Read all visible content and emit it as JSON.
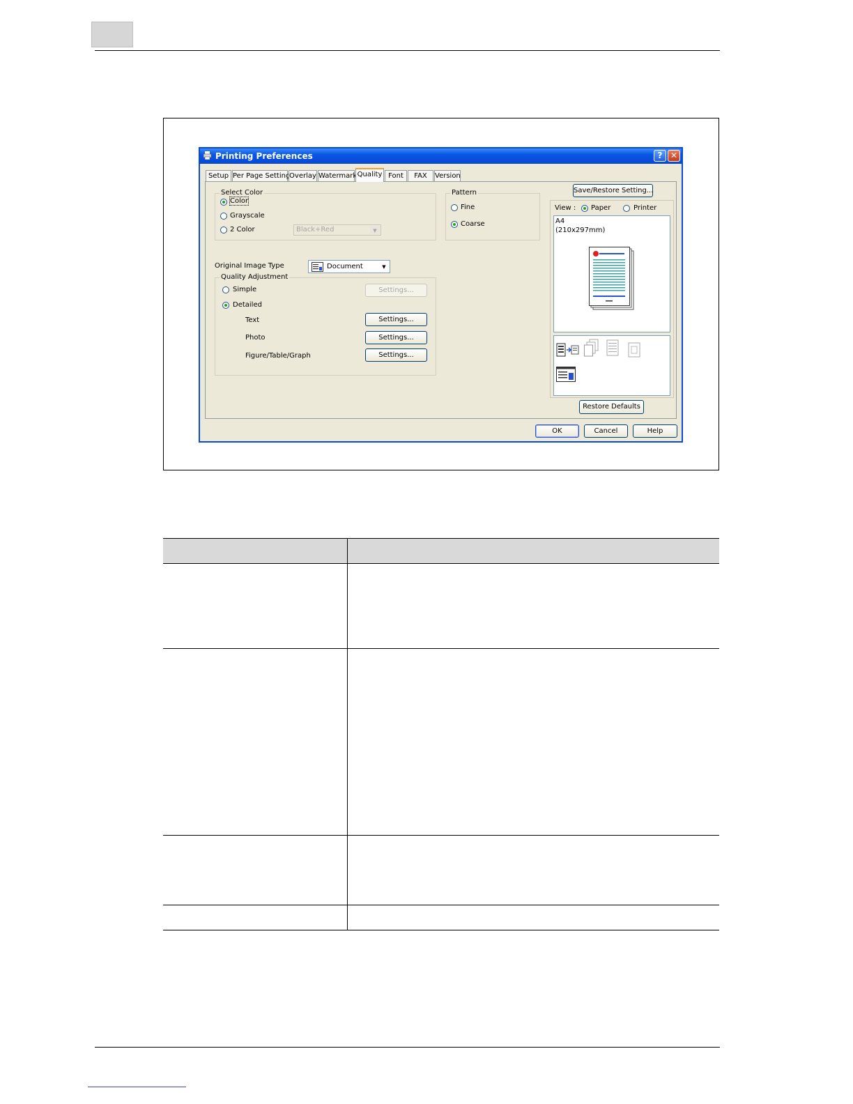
{
  "dialog": {
    "title": "Printing Preferences",
    "help_symbol": "?",
    "close_symbol": "✕",
    "tabs": [
      {
        "label": "Setup"
      },
      {
        "label": "Per Page Setting"
      },
      {
        "label": "Overlay"
      },
      {
        "label": "Watermark"
      },
      {
        "label": "Quality"
      },
      {
        "label": "Font"
      },
      {
        "label": "FAX"
      },
      {
        "label": "Version"
      }
    ],
    "active_tab": "Quality",
    "select_color": {
      "label": "Select Color",
      "options": [
        {
          "label": "Color",
          "selected": true
        },
        {
          "label": "Grayscale",
          "selected": false
        },
        {
          "label": "2 Color",
          "selected": false
        }
      ],
      "two_color_value": "Black+Red",
      "two_color_enabled": false
    },
    "pattern": {
      "label": "Pattern",
      "options": [
        {
          "label": "Fine",
          "selected": false
        },
        {
          "label": "Coarse",
          "selected": true
        }
      ]
    },
    "original_image_type": {
      "label": "Original Image Type",
      "value": "Document"
    },
    "quality_adjustment": {
      "label": "Quality Adjustment",
      "simple_label": "Simple",
      "detailed_label": "Detailed",
      "selected": "Detailed",
      "simple_settings_label": "Settings...",
      "rows": [
        {
          "label": "Text",
          "button": "Settings..."
        },
        {
          "label": "Photo",
          "button": "Settings..."
        },
        {
          "label": "Figure/Table/Graph",
          "button": "Settings..."
        }
      ]
    },
    "save_restore_label": "Save/Restore Setting...",
    "view": {
      "label": "View :",
      "options": [
        {
          "label": "Paper",
          "selected": true
        },
        {
          "label": "Printer",
          "selected": false
        }
      ]
    },
    "preview": {
      "paper_size": "A4",
      "dimensions": "(210x297mm)"
    },
    "restore_defaults_label": "Restore Defaults",
    "ok_label": "OK",
    "cancel_label": "Cancel",
    "help_label": "Help"
  },
  "colors": {
    "titlebar": "#0a56e4",
    "dialog_bg": "#ece9d8",
    "table_header": "#d9d9d9",
    "chapter_box": "#d6d6d6",
    "link_line": "#3a44c8"
  }
}
